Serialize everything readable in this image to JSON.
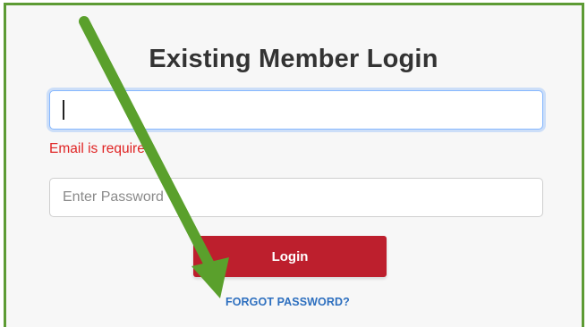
{
  "form": {
    "title": "Existing Member Login",
    "email_value": "",
    "email_error": "Email is required.",
    "password_placeholder": "Enter Password",
    "login_label": "Login",
    "forgot_password_label": "FORGOT PASSWORD?"
  },
  "annotation": {
    "arrow_icon": "arrow-icon",
    "arrow_color": "#5aa02c"
  },
  "colors": {
    "frame_border": "#5d9b34",
    "login_button": "#bd1f2d",
    "error_text": "#e02424",
    "link_text": "#2d6fbf"
  }
}
